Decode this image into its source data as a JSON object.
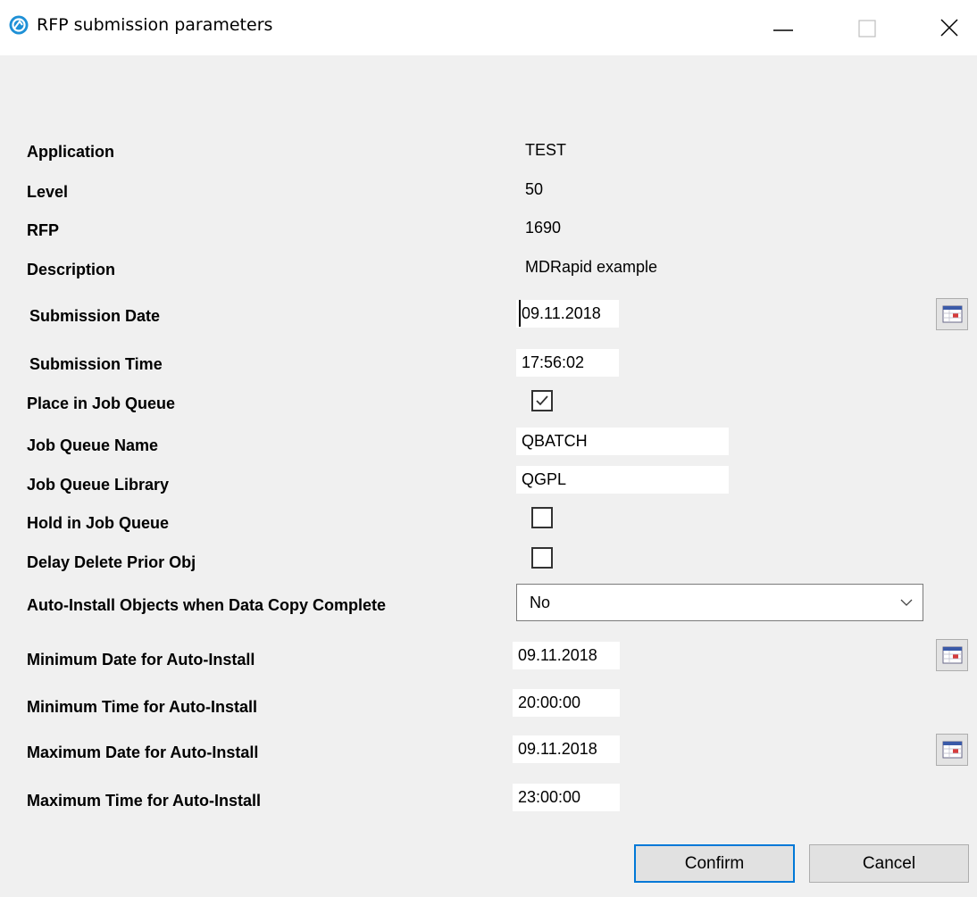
{
  "window": {
    "title": "RFP submission parameters"
  },
  "fields": {
    "application": {
      "label": "Application",
      "value": "TEST"
    },
    "level": {
      "label": "Level",
      "value": "50"
    },
    "rfp": {
      "label": "RFP",
      "value": "1690"
    },
    "description": {
      "label": "Description",
      "value": "MDRapid example"
    },
    "submission_date": {
      "label": "Submission Date",
      "value": "09.11.2018"
    },
    "submission_time": {
      "label": "Submission Time",
      "value": "17:56:02"
    },
    "place_in_job_queue": {
      "label": "Place in Job Queue",
      "checked": true
    },
    "job_queue_name": {
      "label": "Job Queue Name",
      "value": "QBATCH"
    },
    "job_queue_library": {
      "label": "Job Queue Library",
      "value": "QGPL"
    },
    "hold_in_job_queue": {
      "label": "Hold in Job Queue",
      "checked": false
    },
    "delay_delete_prior_obj": {
      "label": "Delay Delete Prior Obj",
      "checked": false
    },
    "auto_install": {
      "label": "Auto-Install Objects when Data Copy Complete",
      "value": "No"
    },
    "min_date": {
      "label": "Minimum Date for Auto-Install",
      "value": "09.11.2018"
    },
    "min_time": {
      "label": "Minimum Time for Auto-Install",
      "value": "20:00:00"
    },
    "max_date": {
      "label": "Maximum Date for Auto-Install",
      "value": "09.11.2018"
    },
    "max_time": {
      "label": "Maximum Time for Auto-Install",
      "value": "23:00:00"
    }
  },
  "buttons": {
    "confirm": "Confirm",
    "cancel": "Cancel"
  },
  "icons": {
    "app": "app-logo-icon",
    "calendar": "calendar-icon",
    "checkmark": "checkmark-icon",
    "dropdown": "chevron-down-icon"
  },
  "colors": {
    "background": "#f0f0f0",
    "focus_border": "#0078d7"
  }
}
